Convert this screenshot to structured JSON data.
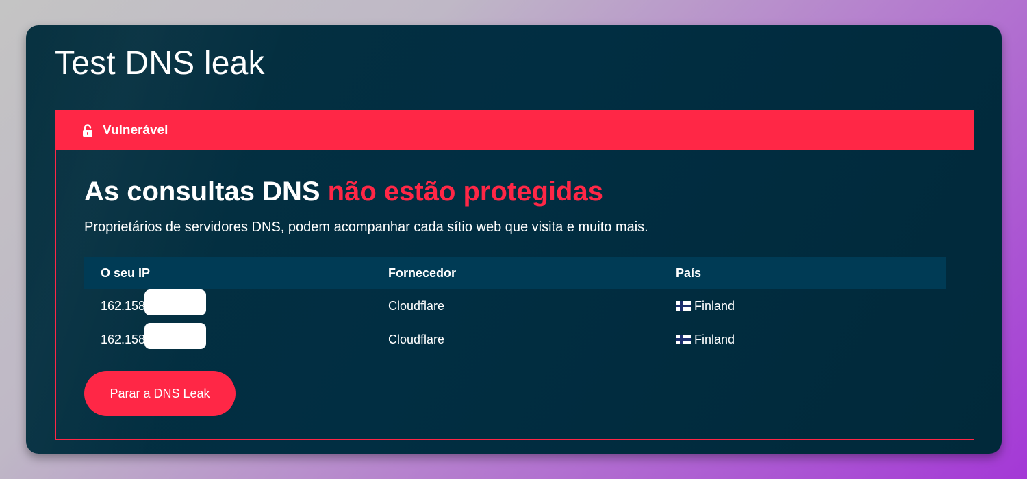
{
  "page": {
    "title": "Test DNS leak"
  },
  "status": {
    "label": "Vulnerável",
    "icon": "unlocked-padlock-icon",
    "color": "#ff2746"
  },
  "headline": {
    "prefix": "As consultas DNS ",
    "highlight": "não estão protegidas"
  },
  "subtext": "Proprietários de servidores DNS, podem acompanhar cada sítio web que visita e muito mais.",
  "table": {
    "headers": {
      "ip": "O seu IP",
      "provider": "Fornecedor",
      "country": "País"
    },
    "rows": [
      {
        "ip": "162.158.",
        "provider": "Cloudflare",
        "country": "Finland",
        "flag": "finland-flag-icon"
      },
      {
        "ip": "162.158.",
        "provider": "Cloudflare",
        "country": "Finland",
        "flag": "finland-flag-icon"
      }
    ]
  },
  "actions": {
    "stop_label": "Parar a DNS Leak"
  },
  "colors": {
    "card_bg": "#012e42",
    "accent_red": "#ff2746",
    "table_header_bg": "#003b55"
  }
}
